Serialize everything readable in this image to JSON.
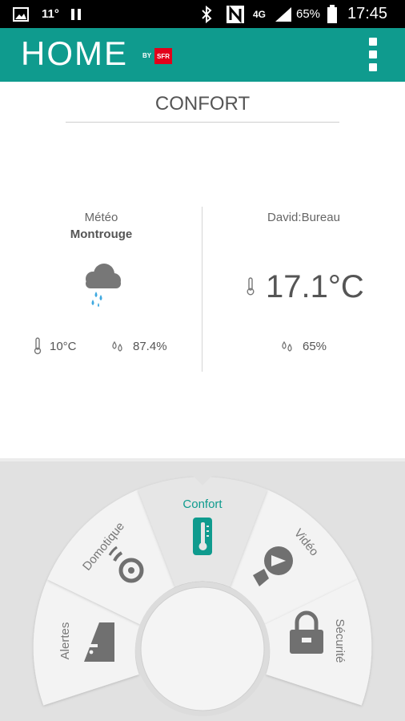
{
  "status_bar": {
    "temperature": "11°",
    "network_type": "4G",
    "battery_percent": "65%",
    "clock": "17:45"
  },
  "app_bar": {
    "logo_text": "HOME",
    "logo_by": "BY",
    "logo_brand": "SFR",
    "menu_icon": "overflow-menu-icon"
  },
  "page": {
    "title": "CONFORT"
  },
  "weather": {
    "label": "Météo",
    "city": "Montrouge",
    "icon": "rain-cloud-icon",
    "temperature": "10°C",
    "humidity": "87.4%"
  },
  "room": {
    "label": "David:Bureau",
    "temperature": "17.1°C",
    "humidity": "65%"
  },
  "nav_wheel": {
    "active": "Confort",
    "segments": [
      {
        "label": "Alertes",
        "icon": "alert-icon"
      },
      {
        "label": "Domotique",
        "icon": "remote-control-icon"
      },
      {
        "label": "Confort",
        "icon": "thermometer-icon"
      },
      {
        "label": "Vidéo",
        "icon": "camera-icon"
      },
      {
        "label": "Sécurité",
        "icon": "lock-icon"
      }
    ]
  },
  "colors": {
    "accent": "#0f9b8e",
    "status_bar": "#000000",
    "dock_background": "#e1e1e1",
    "sfr_red": "#e2001a"
  }
}
